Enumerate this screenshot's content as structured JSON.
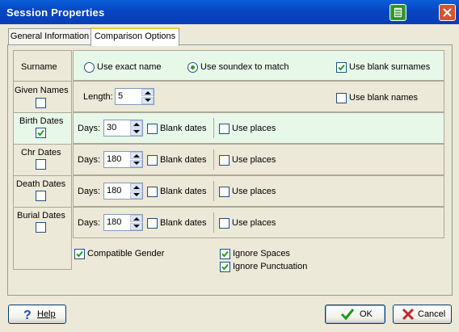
{
  "window": {
    "title": "Session Properties"
  },
  "tabs": [
    {
      "label": "General Information"
    },
    {
      "label": "Comparison Options"
    }
  ],
  "rows": {
    "surname": {
      "label": "Surname",
      "radio1": "Use exact name",
      "radio2": "Use soundex to match",
      "radio_selected": "Use soundex to match",
      "blank_label": "Use blank surnames",
      "blank_checked": true
    },
    "given": {
      "label": "Given Names",
      "checked": false,
      "length_label": "Length:",
      "length_value": "5",
      "blank_label": "Use blank names",
      "blank_checked": false
    },
    "birth": {
      "label": "Birth Dates",
      "checked": true,
      "days_label": "Days:",
      "days_value": "30",
      "blank_label": "Blank dates",
      "blank_checked": false,
      "places_label": "Use places",
      "places_checked": false
    },
    "chr": {
      "label": "Chr Dates",
      "checked": false,
      "days_label": "Days:",
      "days_value": "180",
      "blank_label": "Blank dates",
      "blank_checked": false,
      "places_label": "Use places",
      "places_checked": false
    },
    "death": {
      "label": "Death Dates",
      "checked": false,
      "days_label": "Days:",
      "days_value": "180",
      "blank_label": "Blank dates",
      "blank_checked": false,
      "places_label": "Use places",
      "places_checked": false
    },
    "burial": {
      "label": "Burial Dates",
      "checked": false,
      "days_label": "Days:",
      "days_value": "180",
      "blank_label": "Blank dates",
      "blank_checked": false,
      "places_label": "Use places",
      "places_checked": false
    }
  },
  "options": {
    "compatible_gender": "Compatible Gender",
    "ignore_spaces": "Ignore Spaces",
    "ignore_punctuation": "Ignore Punctuation"
  },
  "buttons": {
    "help": "Help",
    "ok": "OK",
    "cancel": "Cancel"
  },
  "colors": {
    "titlebar": "#0845c3",
    "highlight_row": "#e8f8e8",
    "check_green": "#21a121"
  }
}
